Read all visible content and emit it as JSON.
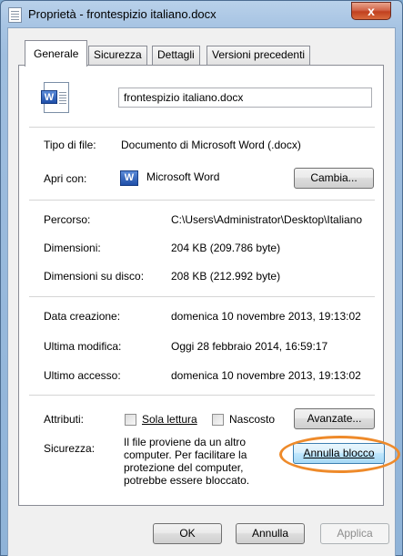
{
  "window": {
    "title": "Proprietà - frontespizio italiano.docx",
    "close_glyph": "x"
  },
  "tabs": [
    {
      "label": "Generale"
    },
    {
      "label": "Sicurezza"
    },
    {
      "label": "Dettagli"
    },
    {
      "label": "Versioni precedenti"
    }
  ],
  "file": {
    "name": "frontespizio italiano.docx",
    "icon": "word-document-icon"
  },
  "type": {
    "label": "Tipo di file:",
    "value": "Documento di Microsoft Word (.docx)"
  },
  "open_with": {
    "label": "Apri con:",
    "app": "Microsoft Word",
    "app_icon": "word-icon",
    "change_button": "Cambia..."
  },
  "location": {
    "label": "Percorso:",
    "value": "C:\\Users\\Administrator\\Desktop\\Italiano"
  },
  "size": {
    "label": "Dimensioni:",
    "value": "204 KB (209.786 byte)"
  },
  "size_on_disk": {
    "label": "Dimensioni su disco:",
    "value": "208 KB (212.992 byte)"
  },
  "created": {
    "label": "Data creazione:",
    "value": "domenica 10 novembre 2013, 19:13:02"
  },
  "modified": {
    "label": "Ultima modifica:",
    "value": "Oggi 28 febbraio 2014, 16:59:17"
  },
  "accessed": {
    "label": "Ultimo accesso:",
    "value": "domenica 10 novembre 2013, 19:13:02"
  },
  "attributes": {
    "label": "Attributi:",
    "readonly_label": "Sola lettura",
    "readonly_checked": false,
    "hidden_label": "Nascosto",
    "hidden_checked": false,
    "advanced_button": "Avanzate..."
  },
  "security": {
    "label": "Sicurezza:",
    "text_lines": [
      "Il file proviene da un altro",
      "computer. Per facilitare la",
      "protezione del computer,",
      "potrebbe essere bloccato."
    ],
    "unblock_button": "Annulla blocco",
    "highlight_color": "#ee8a2a"
  },
  "footer": {
    "ok": "OK",
    "cancel": "Annulla",
    "apply": "Applica"
  }
}
